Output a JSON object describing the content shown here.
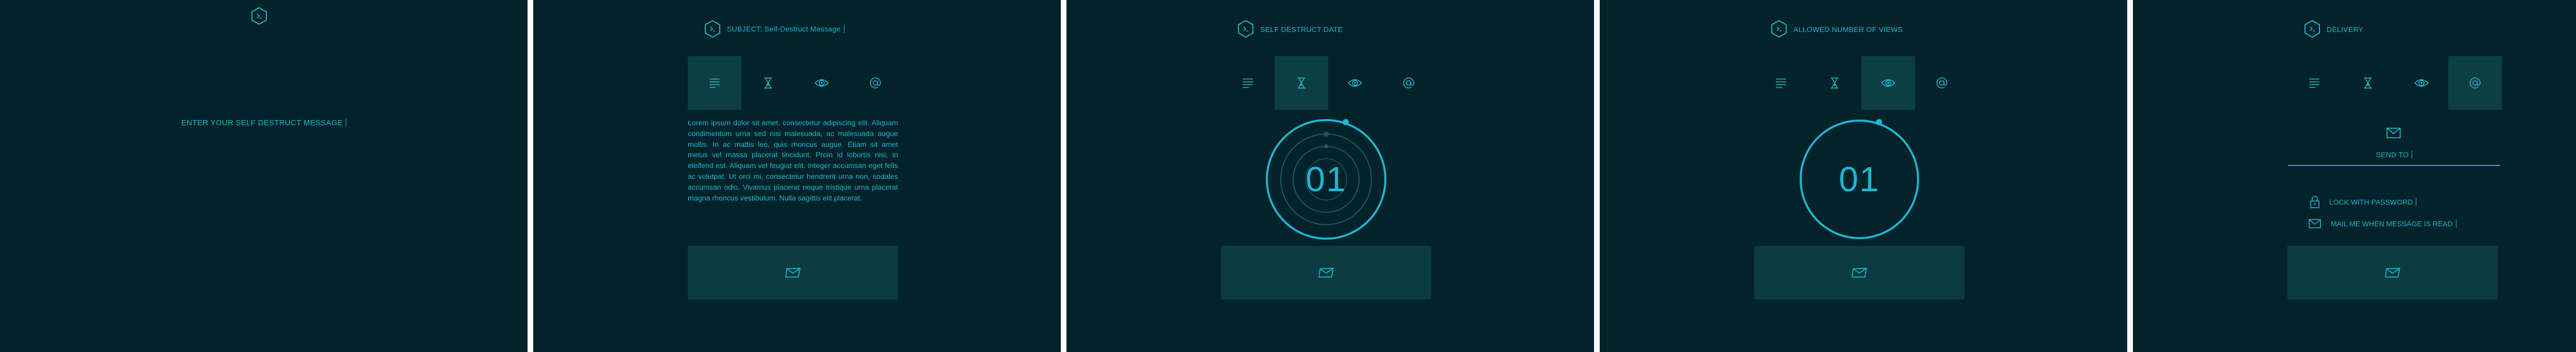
{
  "screens": {
    "compose": {
      "prompt": "ENTER YOUR SELF DESTRUCT MESSAGE"
    },
    "message": {
      "subject_label": "SUBJECT:",
      "subject_value": "Self-Destruct Message",
      "body": "Lorem ipsum dolor sit amet, consectetur adipiscing elit. Aliquam condimentum urna sed nisi malesuada, ac malesuada augue mollis. In ac mattis leo, quis rhoncus augue. Etiam sit amet metus vel massa placerat tincidunt. Proin id lobortis nisi, in eleifend est. Aliquam vel feugiat elit. Integer accumsan eget felis ac volutpat. Ut orci mi, consectetur hendrerit urna non, sodales accumsan odio. Vivamus placerat neque tristique urna placerat magna rhoncus vestibulum. Nulla sagittis elit placerat."
    },
    "date": {
      "title": "SELF DESTRUCT DATE",
      "counter": "01"
    },
    "views": {
      "title": "ALLOWED NUMBER OF VIEWS",
      "counter": "01"
    },
    "delivery": {
      "title": "DELIVERY",
      "send_to_label": "SEND TO",
      "lock_label": "LOCK WITH PASSWORD",
      "mail_label": "MAIL ME WHEN MESSAGE IS READ"
    }
  },
  "tabs": [
    {
      "icon": "message-lines-icon"
    },
    {
      "icon": "hourglass-icon"
    },
    {
      "icon": "eye-icon"
    },
    {
      "icon": "at-sign-icon"
    }
  ],
  "colors": {
    "background": "#03232a",
    "accent": "#1db6d1",
    "active_tab": "#0b3f43",
    "button": "#0a3c3f"
  }
}
